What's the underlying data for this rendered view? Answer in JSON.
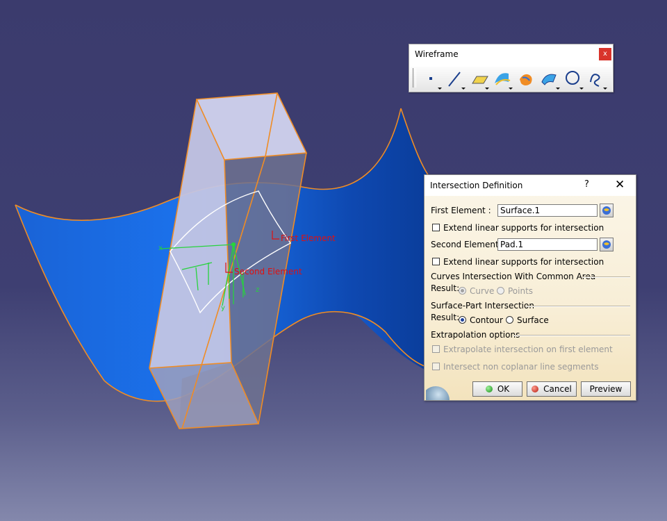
{
  "viewport": {
    "annotations": {
      "first_element": "First Element",
      "second_element": "Second Element"
    },
    "colors": {
      "surface": "#1a6fe8",
      "box_edges": "#f08c24",
      "box_faces": "#c8cae6",
      "axis": "#27d33c",
      "annotation": "#e01010"
    }
  },
  "toolbar": {
    "title": "Wireframe",
    "close_label": "x",
    "tools": [
      {
        "name": "point-icon"
      },
      {
        "name": "line-icon"
      },
      {
        "name": "plane-icon"
      },
      {
        "name": "projection-icon"
      },
      {
        "name": "intersection-icon"
      },
      {
        "name": "offset-icon"
      },
      {
        "name": "circle-icon"
      },
      {
        "name": "spline-icon"
      }
    ]
  },
  "dialog": {
    "title": "Intersection Definition",
    "help": "?",
    "close": "✕",
    "first_element": {
      "label": "First Element :",
      "value": "Surface.1"
    },
    "extend_first": {
      "label": "Extend linear supports for intersection",
      "checked": false
    },
    "second_element": {
      "label": "Second Element :",
      "value": "Pad.1"
    },
    "extend_second": {
      "label": "Extend linear supports for intersection",
      "checked": false
    },
    "curves_section": {
      "title": "Curves Intersection With Common Area",
      "result_label": "Result:",
      "options": [
        "Curve",
        "Points"
      ],
      "selected": "Curve",
      "enabled": false
    },
    "surface_section": {
      "title": "Surface-Part Intersection",
      "result_label": "Result:",
      "options": [
        "Contour",
        "Surface"
      ],
      "selected": "Contour"
    },
    "extrapolation": {
      "title": "Extrapolation options",
      "opt1": "Extrapolate intersection on first element",
      "opt2": "Intersect non coplanar line segments"
    },
    "buttons": {
      "ok": "OK",
      "cancel": "Cancel",
      "preview": "Preview"
    }
  }
}
